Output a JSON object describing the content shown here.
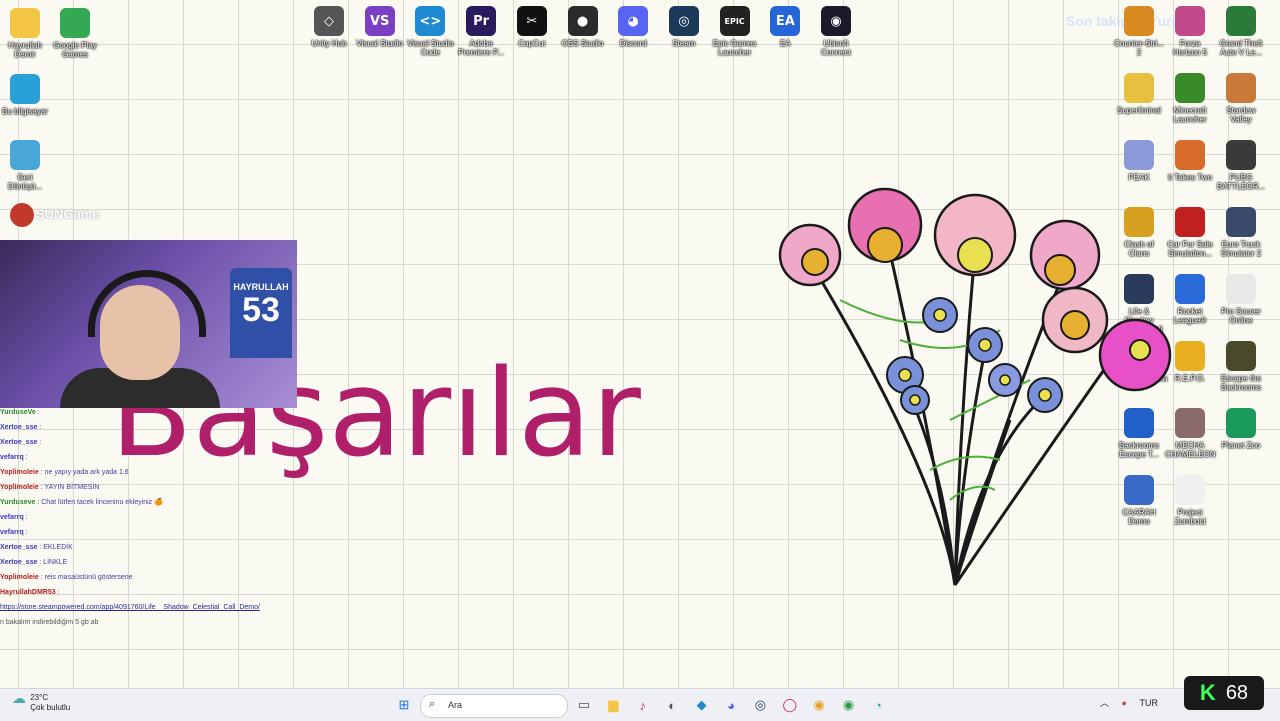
{
  "overlay": {
    "follower_text": "Son takipçi: Yurduse"
  },
  "watermark": {
    "text": "SUNGame"
  },
  "desktop_icons_left": [
    {
      "label": "Hayrullah Demir",
      "icon": "folder-icon",
      "color": "#f4c542"
    },
    {
      "label": "Google Play Games",
      "icon": "google-play-games-icon",
      "color": "#34a853"
    },
    {
      "label": "Bu bilgisayar",
      "icon": "monitor-icon",
      "color": "#2aa0d8"
    },
    {
      "label": "Geri Dönüşü...",
      "icon": "recycle-bin-icon",
      "color": "#4aa8d8"
    }
  ],
  "desktop_icons_top": [
    {
      "label": "Unity Hub",
      "icon": "unity-hub-icon",
      "color": "#555555",
      "glyph": "◇"
    },
    {
      "label": "Visual Studio",
      "icon": "visual-studio-icon",
      "color": "#7b3fc4",
      "glyph": "VS"
    },
    {
      "label": "Visual Studio Code",
      "icon": "vscode-icon",
      "color": "#1f8ad2",
      "glyph": "<>"
    },
    {
      "label": "Adobe Premiere P...",
      "icon": "premiere-pro-icon",
      "color": "#2a1a5e",
      "glyph": "Pr"
    },
    {
      "label": "CapCut",
      "icon": "capcut-icon",
      "color": "#111111",
      "glyph": "✂"
    },
    {
      "label": "OBS Studio",
      "icon": "obs-studio-icon",
      "color": "#2b2b2b",
      "glyph": "●"
    },
    {
      "label": "Discord",
      "icon": "discord-icon",
      "color": "#5865f2",
      "glyph": "◕"
    },
    {
      "label": "Steam",
      "icon": "steam-icon",
      "color": "#1b3a5a",
      "glyph": "◎"
    },
    {
      "label": "Epic Games Launcher",
      "icon": "epic-games-icon",
      "color": "#222222",
      "glyph": "EPIC"
    },
    {
      "label": "EA",
      "icon": "ea-icon",
      "color": "#2565d8",
      "glyph": "EA"
    },
    {
      "label": "Ubisoft Connect",
      "icon": "ubisoft-connect-icon",
      "color": "#1a1a2a",
      "glyph": "◉"
    }
  ],
  "desktop_icons_right": [
    {
      "label": "Counter-Stri... 2",
      "icon": "counter-strike-icon",
      "color": "#d88a20"
    },
    {
      "label": "Forza Horizon 5",
      "icon": "forza-horizon-icon",
      "color": "#c04a8a"
    },
    {
      "label": "Grand Theft Auto V Le...",
      "icon": "gta-v-icon",
      "color": "#2a7a3a"
    },
    {
      "label": "Superliminal",
      "icon": "superliminal-icon",
      "color": "#e8c040"
    },
    {
      "label": "Minecraft Launcher",
      "icon": "minecraft-icon",
      "color": "#3a8a2a"
    },
    {
      "label": "Stardew Valley",
      "icon": "stardew-valley-icon",
      "color": "#c87a3a"
    },
    {
      "label": "PEAK",
      "icon": "peak-icon",
      "color": "#8a9ad8"
    },
    {
      "label": "It Takes Two",
      "icon": "it-takes-two-icon",
      "color": "#d86a2a"
    },
    {
      "label": "PUBG BATTLEGR...",
      "icon": "pubg-icon",
      "color": "#3a3a3a"
    },
    {
      "label": "Clash of Clans",
      "icon": "clash-of-clans-icon",
      "color": "#d8a020"
    },
    {
      "label": "Car For Sale Simulation...",
      "icon": "car-for-sale-icon",
      "color": "#c02020"
    },
    {
      "label": "Euro Truck Simulator 2",
      "icon": "euro-truck-icon",
      "color": "#3a4a6a"
    },
    {
      "label": "Life & Shadow Celestial Call Demo",
      "icon": "life-shadow-icon",
      "color": "#2a3a5a"
    },
    {
      "label": "Rocket League®",
      "icon": "rocket-league-icon",
      "color": "#2a6ad8"
    },
    {
      "label": "Pro Soccer Online",
      "icon": "pro-soccer-icon",
      "color": "#e8e8e8"
    },
    {
      "label": "Phasmophobia",
      "icon": "phasmophobia-icon",
      "color": "#c8a83a"
    },
    {
      "label": "R.E.P.O.",
      "icon": "repo-icon",
      "color": "#e8b020"
    },
    {
      "label": "Escape the Backrooms",
      "icon": "escape-backrooms-icon",
      "color": "#4a4a2a"
    },
    {
      "label": "Backrooms Escape T...",
      "icon": "backrooms-escape-icon",
      "color": "#2060c8"
    },
    {
      "label": "MECHA CHAMELEON",
      "icon": "mecha-chameleon-icon",
      "color": "#8a6a6a"
    },
    {
      "label": "Planet Zoo",
      "icon": "planet-zoo-icon",
      "color": "#1a9a5a"
    },
    {
      "label": "CAARAH Demo",
      "icon": "caarah-icon",
      "color": "#3a6ac8"
    },
    {
      "label": "Project Zomboid",
      "icon": "project-zomboid-icon",
      "color": "#f0f0f0"
    }
  ],
  "canvas": {
    "handwritten_word": "Başarılar",
    "ink_color": "#b0206a"
  },
  "webcam": {
    "jersey_name": "HAYRULLAH",
    "jersey_number": "53"
  },
  "chat": {
    "messages": [
      {
        "user": "YurduseVe",
        "text": ":",
        "kind": "u1"
      },
      {
        "user": "Xertoe_sse",
        "text": ":",
        "kind": "u2"
      },
      {
        "user": "Xertoe_sse",
        "text": ":",
        "kind": "u2"
      },
      {
        "user": "vefarrq",
        "text": ":",
        "kind": "u2"
      },
      {
        "user": "Yoplimoleie",
        "text": ": ne yapıy yada ark yada 1.6",
        "kind": "u3"
      },
      {
        "user": "Yoplimoleie",
        "text": ": YAYIN BİTMESİN",
        "kind": "u3"
      },
      {
        "user": "Yurduseve",
        "text": ": Chat lütfen tacek linceninu ekleyiniz 🍊",
        "kind": "u1"
      },
      {
        "user": "vefarrq",
        "text": ":",
        "kind": "u2"
      },
      {
        "user": "vefarrq",
        "text": ":",
        "kind": "u2"
      },
      {
        "user": "Xertoe_sse",
        "text": ": EKLEDİK",
        "kind": "u2"
      },
      {
        "user": "Xertoe_sse",
        "text": ": LİNKLE",
        "kind": "u2"
      },
      {
        "user": "Yoplimoleie",
        "text": ": reis masaüstünü göstersene",
        "kind": "u3"
      },
      {
        "user": "HayrullahDMR53",
        "text": ":",
        "kind": "u3"
      }
    ],
    "link": "https://store.steampowered.com/app/4091760/Life__Shadow_Celestial_Call_Demo/",
    "footer": "n bakalım indirebildiğim 5 gb ab"
  },
  "taskbar": {
    "weather_temp": "23°C",
    "weather_desc": "Çok bulutlu",
    "search_placeholder": "Ara",
    "apps": [
      {
        "name": "windows-start-icon",
        "glyph": "⊞",
        "color": "#1a73e8"
      },
      {
        "name": "task-view-icon",
        "glyph": "▭",
        "color": "#555"
      },
      {
        "name": "file-explorer-icon",
        "glyph": "▆",
        "color": "#f4c542"
      },
      {
        "name": "music-app-icon",
        "glyph": "♪",
        "color": "#e0305a"
      },
      {
        "name": "opera-icon",
        "glyph": "◐",
        "color": "#555"
      },
      {
        "name": "vscode-taskbar-icon",
        "glyph": "◆",
        "color": "#1f8ad2"
      },
      {
        "name": "discord-taskbar-icon",
        "glyph": "◕",
        "color": "#5865f2"
      },
      {
        "name": "steam-taskbar-icon",
        "glyph": "◎",
        "color": "#1b3a5a"
      },
      {
        "name": "opera-gx-icon",
        "glyph": "◯",
        "color": "#d82040"
      },
      {
        "name": "chrome-icon",
        "glyph": "◉",
        "color": "#e8a020"
      },
      {
        "name": "chrome-2-icon",
        "glyph": "◉",
        "color": "#2a9a4a"
      },
      {
        "name": "edge-icon",
        "glyph": "◔",
        "color": "#1ab0b0"
      }
    ],
    "tray_lang": "TUR"
  },
  "kick_counter": {
    "value": "68"
  }
}
